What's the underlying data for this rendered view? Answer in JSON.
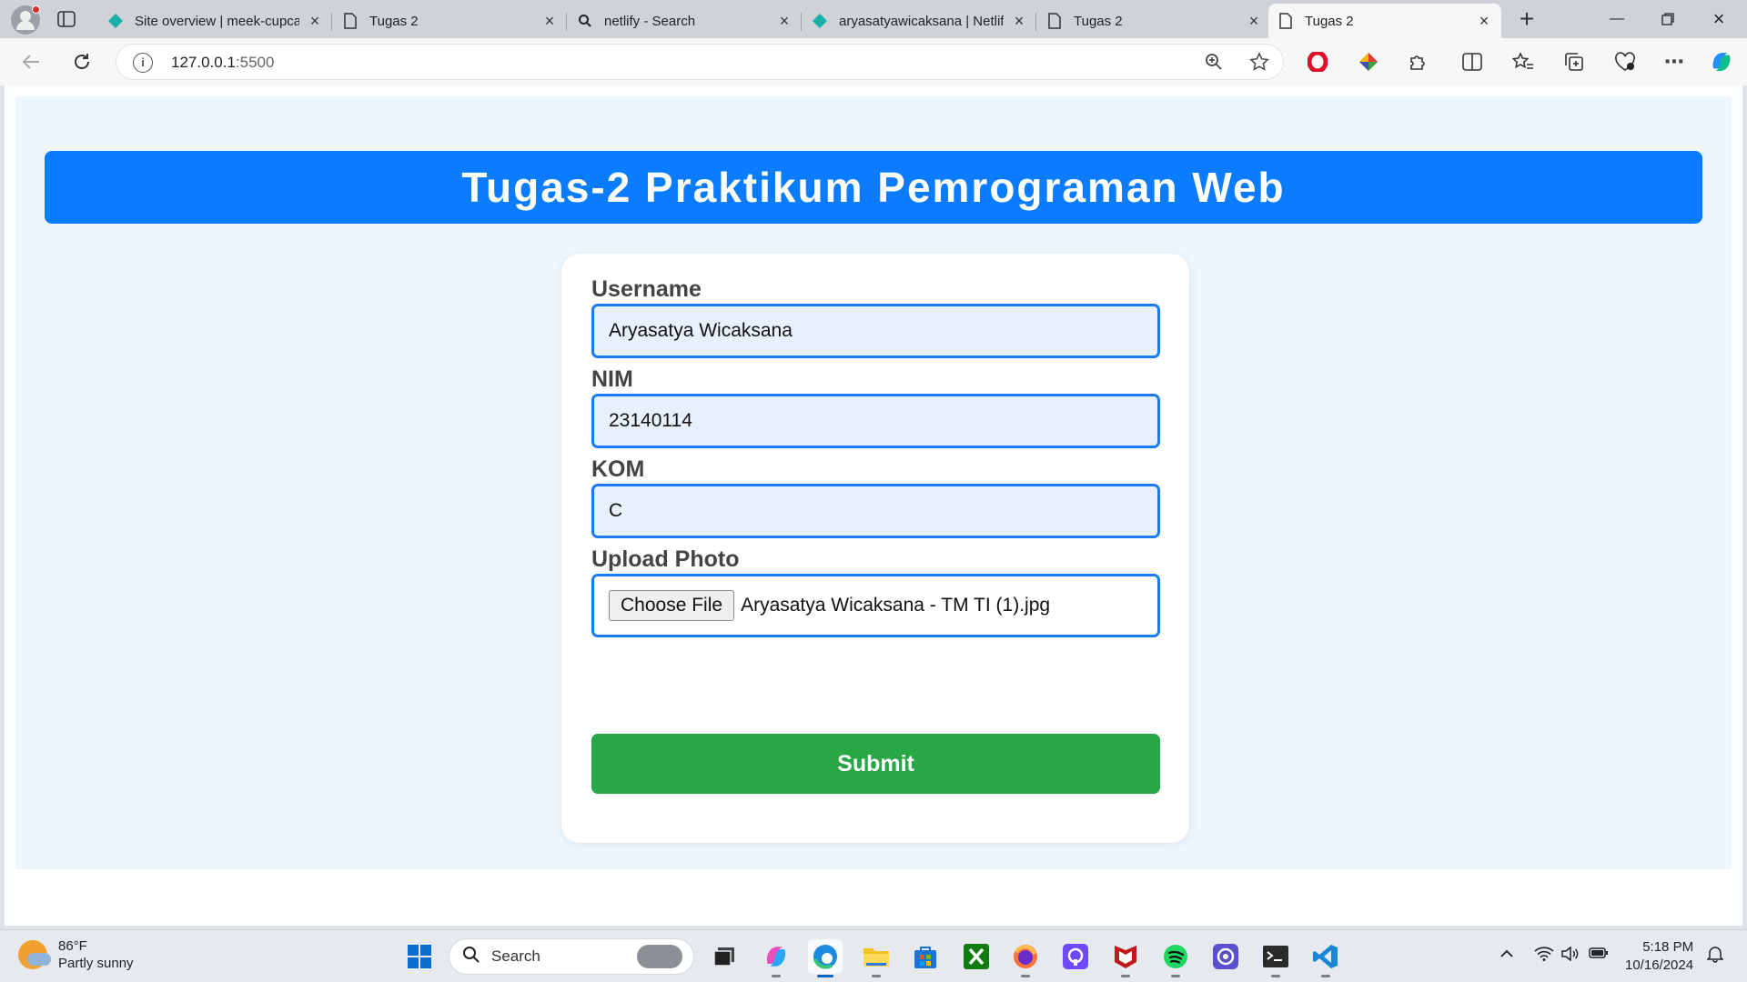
{
  "browser": {
    "tabs": [
      {
        "title": "Site overview | meek-cupcake",
        "favicon": "netlify-icon"
      },
      {
        "title": "Tugas 2",
        "favicon": "page-icon"
      },
      {
        "title": "netlify - Search",
        "favicon": "search-icon"
      },
      {
        "title": "aryasatyawicaksana | Netlify",
        "favicon": "netlify-icon"
      },
      {
        "title": "Tugas 2",
        "favicon": "page-icon"
      },
      {
        "title": "Tugas 2",
        "favicon": "page-icon"
      }
    ],
    "active_tab_index": 5,
    "url_host": "127.0.0.1",
    "url_port": ":5500"
  },
  "page": {
    "banner_title": "Tugas-2 Praktikum Pemrograman Web",
    "form": {
      "username_label": "Username",
      "username_value": "Aryasatya Wicaksana",
      "nim_label": "NIM",
      "nim_value": "23140114",
      "kom_label": "KOM",
      "kom_value": "C",
      "photo_label": "Upload Photo",
      "choose_file_label": "Choose File",
      "file_name": "Aryasatya Wicaksana - TM TI (1).jpg",
      "submit_label": "Submit"
    },
    "colors": {
      "banner": "#0a7cfd",
      "input_border": "#1a7cf0",
      "submit": "#28a745",
      "page_background": "#eef6ff"
    }
  },
  "taskbar": {
    "weather_temp": "86°F",
    "weather_desc": "Partly sunny",
    "search_placeholder": "Search",
    "time": "5:18 PM",
    "date": "10/16/2024"
  }
}
